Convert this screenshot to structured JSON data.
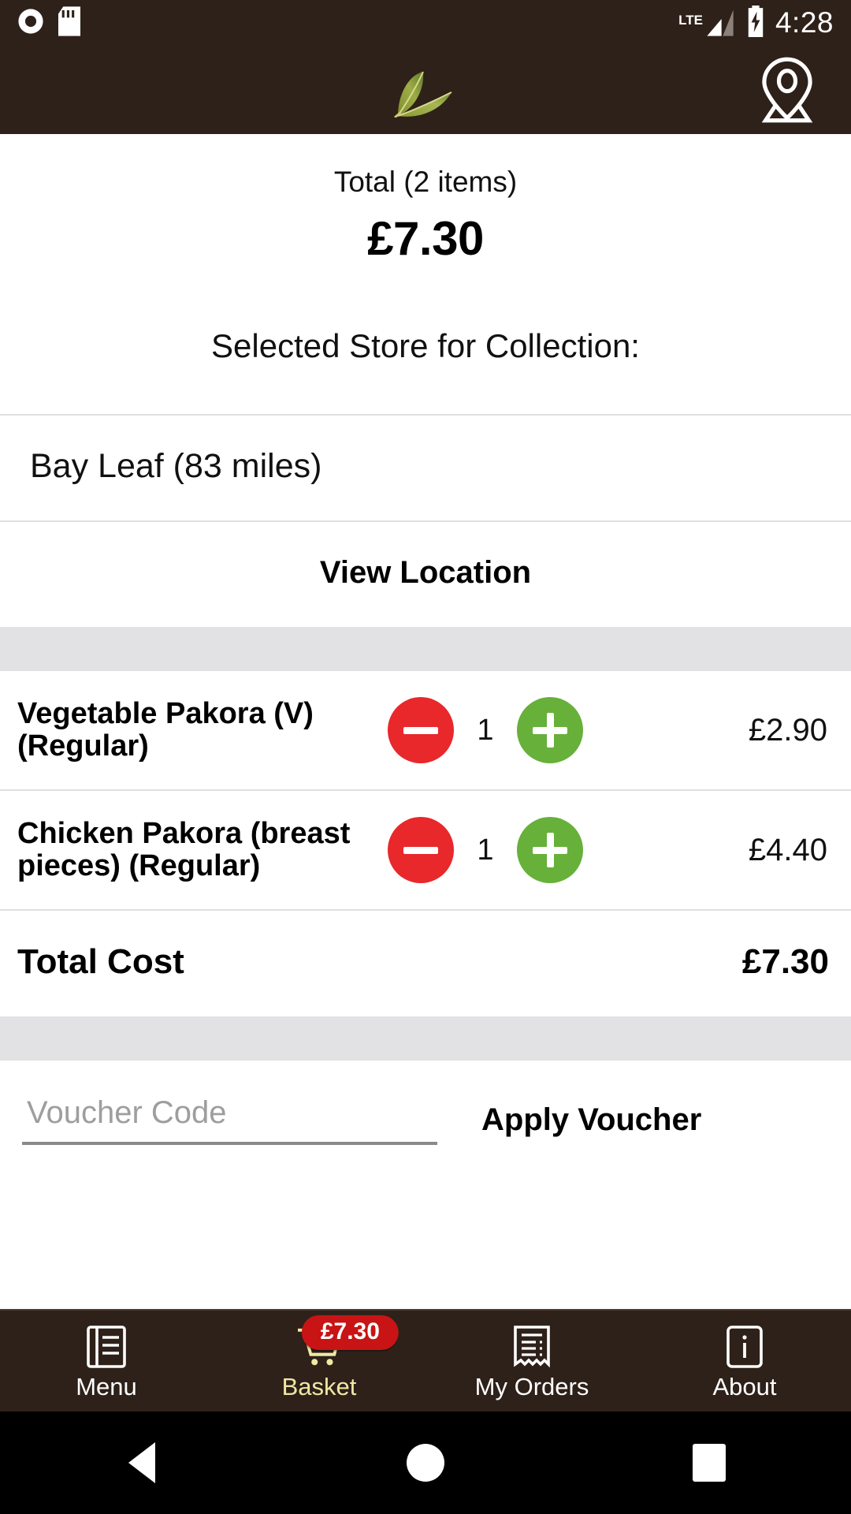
{
  "status_bar": {
    "time": "4:28",
    "network_label": "LTE",
    "icons": [
      "record-icon",
      "sd-card-icon",
      "signal-icon",
      "battery-charging-icon"
    ]
  },
  "app_bar": {
    "logo": "bay-leaf-logo",
    "location_icon": "map-pin-icon"
  },
  "summary": {
    "label": "Total (2 items)",
    "total": "£7.30"
  },
  "collection": {
    "title": "Selected Store for Collection:",
    "store_name": "Bay Leaf (83 miles)",
    "view_location_label": "View Location"
  },
  "basket": {
    "items": [
      {
        "name": "Vegetable Pakora (V) (Regular)",
        "quantity": "1",
        "price": "£2.90",
        "decrease_label": "-",
        "increase_label": "+"
      },
      {
        "name": "Chicken Pakora (breast pieces) (Regular)",
        "quantity": "1",
        "price": "£4.40",
        "decrease_label": "-",
        "increase_label": "+"
      }
    ],
    "total_label": "Total Cost",
    "total_value": "£7.30"
  },
  "voucher": {
    "placeholder": "Voucher Code",
    "value": "",
    "apply_label": "Apply Voucher"
  },
  "bottom_nav": {
    "items": [
      {
        "label": "Menu",
        "icon": "menu-book-icon",
        "active": false
      },
      {
        "label": "Basket",
        "icon": "shopping-cart-icon",
        "active": true,
        "badge": "£7.30"
      },
      {
        "label": "My Orders",
        "icon": "receipt-icon",
        "active": false
      },
      {
        "label": "About",
        "icon": "info-icon",
        "active": false
      }
    ]
  },
  "system_nav": {
    "back": "back-button",
    "home": "home-button",
    "recents": "recents-button"
  },
  "colors": {
    "brand_brown": "#2E211A",
    "minus_red": "#E8282B",
    "plus_green": "#67B03A",
    "badge_red": "#C81414",
    "active_nav": "#EFE9A3",
    "band_gray": "#E2E2E4"
  }
}
